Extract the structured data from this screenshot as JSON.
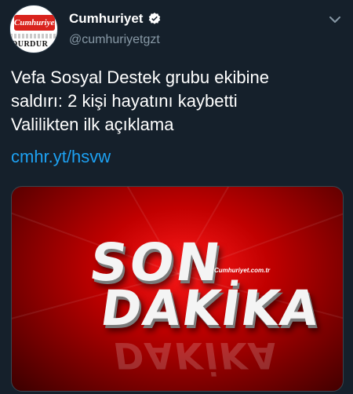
{
  "account": {
    "display_name": "Cumhuriyet",
    "handle": "@cumhuriyetgzt",
    "avatar_logo": "Cumhuriyet",
    "avatar_bottom_text": "DURDUR"
  },
  "tweet": {
    "lines": [
      "Vefa Sosyal Destek grubu ekibine",
      "saldırı: 2 kişi hayatını kaybetti",
      "Valilikten ilk açıklama"
    ],
    "link": "cmhr.yt/hsvw"
  },
  "media": {
    "headline_top": "SON",
    "headline_bottom": "DAKİKA",
    "brand": "Cumhuriyet.com.tr",
    "reflection": "DAKİKA"
  },
  "icons": {
    "verified": "verified-badge-icon",
    "menu": "chevron-down-icon"
  },
  "colors": {
    "background": "#15202b",
    "link": "#1da1f2",
    "secondary_text": "#8899a6",
    "brand_red": "#d9231d"
  }
}
